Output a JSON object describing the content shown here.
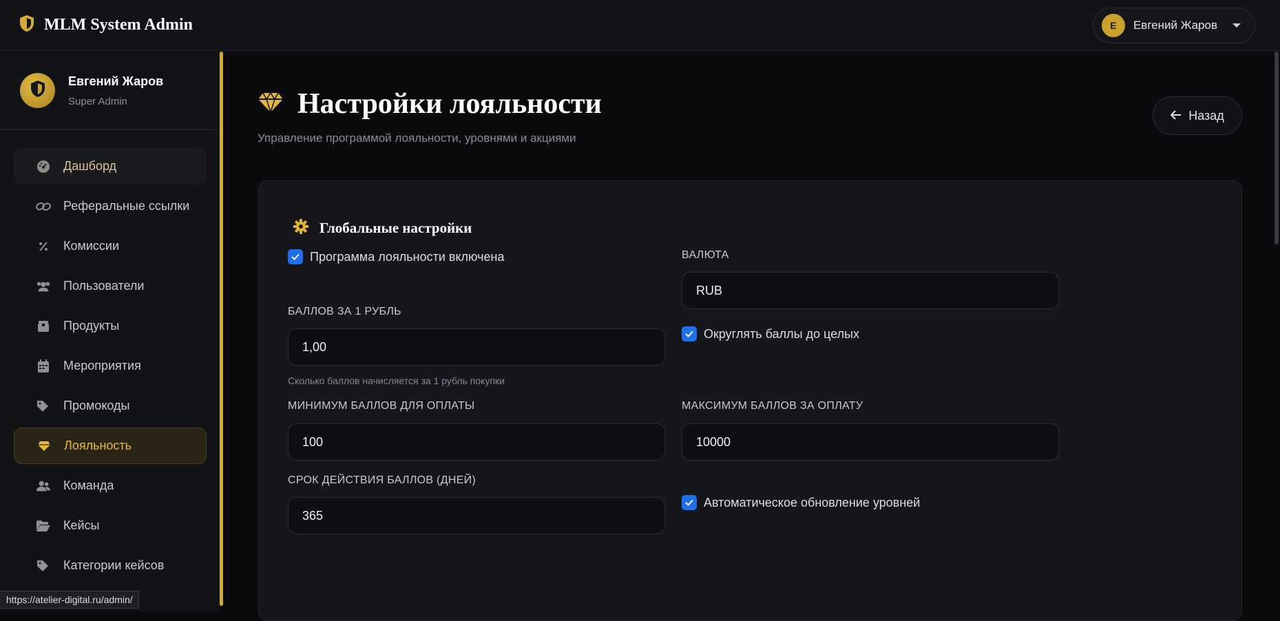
{
  "app": {
    "title": "MLM System Admin"
  },
  "topbar": {
    "user_initial": "Е",
    "user_name": "Евгений Жаров"
  },
  "profile": {
    "name": "Евгений Жаров",
    "role": "Super Admin"
  },
  "sidebar": {
    "items": [
      {
        "label": "Дашборд",
        "icon": "dashboard-icon"
      },
      {
        "label": "Реферальные ссылки",
        "icon": "link-icon"
      },
      {
        "label": "Комиссии",
        "icon": "percent-icon"
      },
      {
        "label": "Пользователи",
        "icon": "users-icon"
      },
      {
        "label": "Продукты",
        "icon": "box-icon"
      },
      {
        "label": "Мероприятия",
        "icon": "calendar-icon"
      },
      {
        "label": "Промокоды",
        "icon": "tags-icon"
      },
      {
        "label": "Лояльность",
        "icon": "gem-icon"
      },
      {
        "label": "Команда",
        "icon": "team-icon"
      },
      {
        "label": "Кейсы",
        "icon": "folder-icon"
      },
      {
        "label": "Категории кейсов",
        "icon": "tag-icon"
      }
    ]
  },
  "status_url": "https://atelier-digital.ru/admin/",
  "page": {
    "title": "Настройки лояльности",
    "subtitle": "Управление программой лояльности, уровнями и акциями",
    "back_label": "Назад"
  },
  "settings": {
    "section_title": "Глобальные настройки",
    "program_enabled_label": "Программа лояльности включена",
    "currency_label": "ВАЛЮТА",
    "currency_value": "RUB",
    "points_per_ruble_label": "БАЛЛОВ ЗА 1 РУБЛЬ",
    "points_per_ruble_value": "1,00",
    "points_per_ruble_hint": "Сколько баллов начисляется за 1 рубль покупки",
    "round_points_label": "Округлять баллы до целых",
    "min_points_label": "МИНИМУМ БАЛЛОВ ДЛЯ ОПЛАТЫ",
    "min_points_value": "100",
    "max_points_label": "МАКСИМУМ БАЛЛОВ ЗА ОПЛАТУ",
    "max_points_value": "10000",
    "expiry_label": "СРОК ДЕЙСТВИЯ БАЛЛОВ (ДНЕЙ)",
    "expiry_value": "365",
    "auto_levels_label": "Автоматическое обновление уровней"
  },
  "colors": {
    "accent": "#d4ab36",
    "checkbox": "#1f6feb",
    "background": "#0b0b0e"
  }
}
